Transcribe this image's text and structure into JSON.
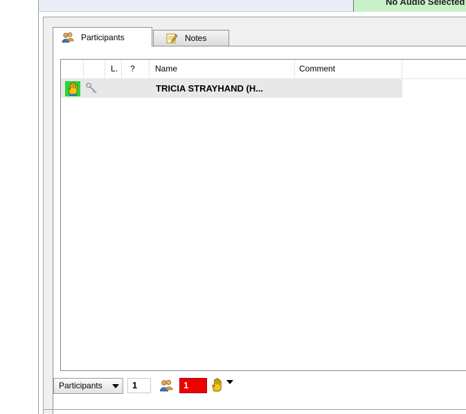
{
  "audio_status": {
    "text": "No Audio Selected",
    "color": "#c9f1c7"
  },
  "tabs": [
    {
      "label": "Participants",
      "icon": "participants-icon",
      "active": true
    },
    {
      "label": "Notes",
      "icon": "notes-icon",
      "active": false
    }
  ],
  "list": {
    "columns": [
      "",
      "",
      "L.",
      "?",
      "Name",
      "Comment"
    ],
    "rows": [
      {
        "status_icon": "raised-hand-icon",
        "role_icon": "key-icon",
        "name": "TRICIA STRAYHAND (H..."
      }
    ]
  },
  "toolbar": {
    "view_label": "Participants",
    "participant_count": "1",
    "raised_hand_count": "1",
    "raised_hand_color": "#ee0000"
  }
}
